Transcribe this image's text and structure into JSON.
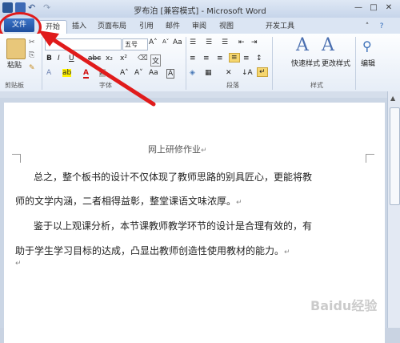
{
  "window": {
    "title": "罗布泊 [兼容模式] - Microsoft Word",
    "qa_icons": [
      "word-icon",
      "save-icon",
      "undo-icon",
      "redo-icon"
    ],
    "controls": [
      "—",
      "□",
      "✕"
    ]
  },
  "tabs": {
    "file": "文件",
    "items": [
      "开始",
      "插入",
      "页面布局",
      "引用",
      "邮件",
      "审阅",
      "视图",
      "开发工具"
    ],
    "active": "开始"
  },
  "ribbon": {
    "clipboard": {
      "paste": "粘贴",
      "group": "剪贴板"
    },
    "font": {
      "name": "",
      "size": "五号",
      "grow": "A˄",
      "shrink": "A˅",
      "aa": "Aa",
      "group": "字体",
      "bold": "B",
      "italic": "I",
      "underline": "U",
      "strike": "abc",
      "sub": "x₂",
      "sup": "x²",
      "color_a": "A",
      "wen": "文"
    },
    "paragraph": {
      "group": "段落"
    },
    "styles": {
      "quick": "快速样式",
      "change": "更改样式",
      "group": "样式"
    },
    "editing": {
      "label": "编辑"
    }
  },
  "document": {
    "header": "网上研修作业",
    "lines": [
      "总之，整个板书的设计不仅体现了教师思路的别具匠心，更能将教",
      "师的文学内涵，二者相得益彰，整堂课语文味浓厚。",
      "鉴于以上观课分析，本节课教师教学环节的设计是合理有效的，有",
      "助于学生学习目标的达成，凸显出教师创造性使用教材的能力。"
    ],
    "para_mark": "↵"
  },
  "watermark": "Baidu经验",
  "colors": {
    "accent": "#1e4e9e",
    "annotation": "#e01b1b"
  }
}
